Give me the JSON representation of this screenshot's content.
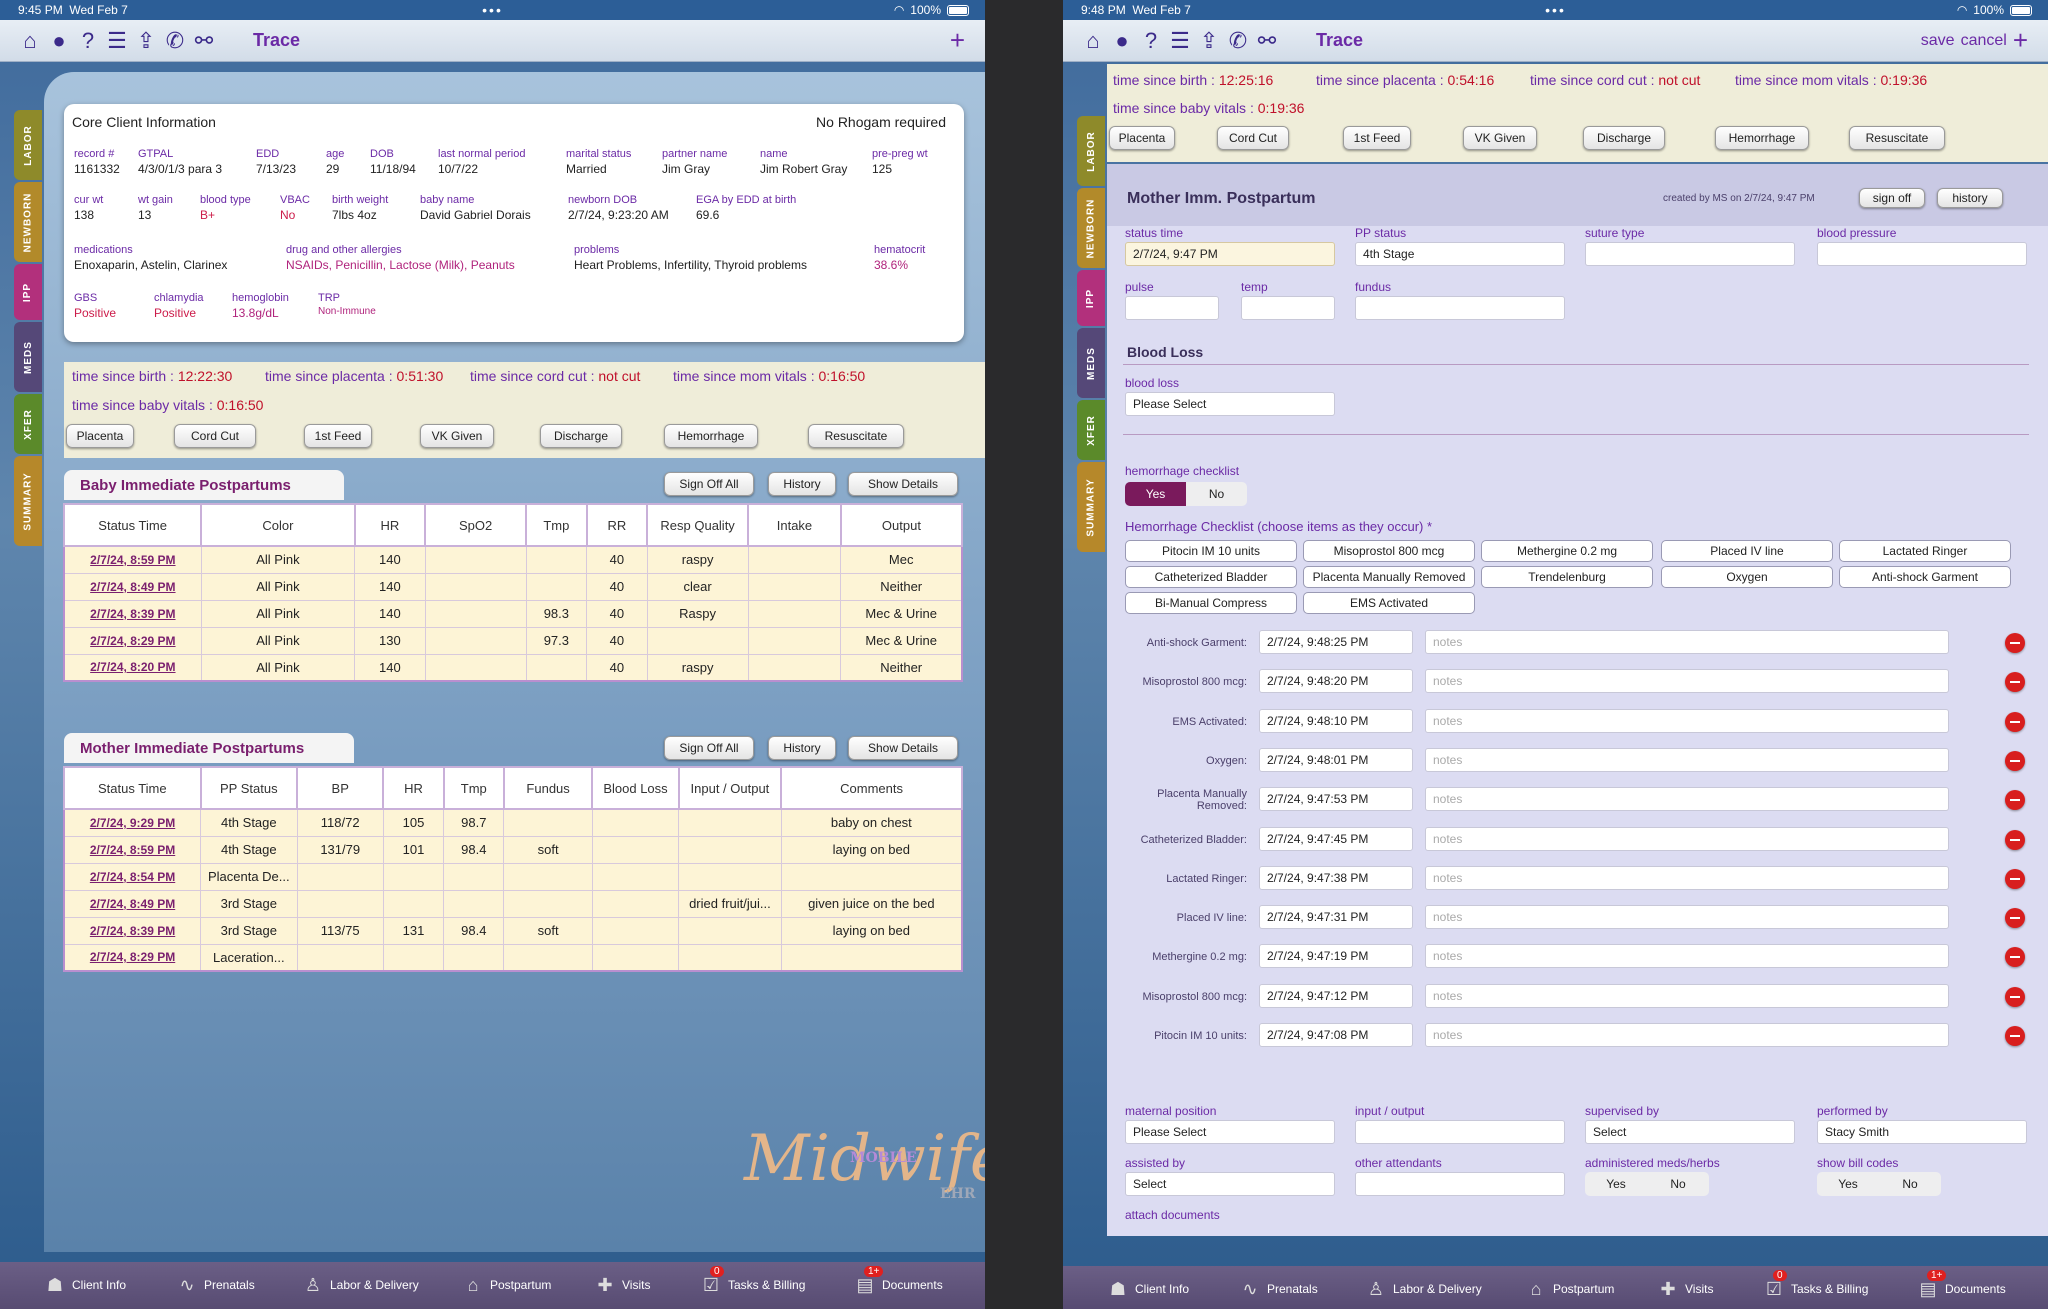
{
  "left": {
    "status": {
      "time": "9:45 PM",
      "date": "Wed Feb 7",
      "battery": "100%"
    },
    "toolbar": {
      "title": "Trace"
    },
    "sidetabs": [
      "LABOR",
      "NEWBORN",
      "IPP",
      "MEDS",
      "XFER",
      "SUMMARY"
    ],
    "core": {
      "title": "Core Client Information",
      "note": "No Rhogam required",
      "rows": [
        [
          {
            "l": "record #",
            "v": "1161332"
          },
          {
            "l": "GTPAL",
            "v": "4/3/0/1/3 para 3"
          },
          {
            "l": "EDD",
            "v": "7/13/23"
          },
          {
            "l": "age",
            "v": "29"
          },
          {
            "l": "DOB",
            "v": "11/18/94"
          },
          {
            "l": "last normal period",
            "v": "10/7/22"
          },
          {
            "l": "marital status",
            "v": "Married"
          },
          {
            "l": "partner name",
            "v": "Jim Gray"
          },
          {
            "l": "name",
            "v": "Jim Robert Gray"
          },
          {
            "l": "pre-preg wt",
            "v": "125"
          }
        ],
        [
          {
            "l": "cur wt",
            "v": "138"
          },
          {
            "l": "wt gain",
            "v": "13"
          },
          {
            "l": "blood type",
            "v": "B+"
          },
          {
            "l": "VBAC",
            "v": "No"
          },
          {
            "l": "birth weight",
            "v": "7lbs 4oz"
          },
          {
            "l": "baby name",
            "v": "David Gabriel Dorais"
          },
          {
            "l": "newborn DOB",
            "v": "2/7/24, 9:23:20 AM"
          },
          {
            "l": "EGA by EDD at birth",
            "v": "69.6"
          }
        ],
        [
          {
            "l": "medications",
            "v": "Enoxaparin, Astelin, Clarinex"
          },
          {
            "l": "drug and other allergies",
            "v": "NSAIDs, Penicillin, Lactose (Milk), Peanuts"
          },
          {
            "l": "problems",
            "v": "Heart Problems, Infertility, Thyroid problems"
          },
          {
            "l": "hematocrit",
            "v": "38.6%"
          }
        ],
        [
          {
            "l": "GBS",
            "v": "Positive"
          },
          {
            "l": "chlamydia",
            "v": "Positive"
          },
          {
            "l": "hemoglobin",
            "v": "13.8g/dL"
          },
          {
            "l": "TRP",
            "v": "Non-Immune"
          }
        ]
      ]
    },
    "timers": [
      {
        "l": "time since birth :",
        "v": "12:22:30"
      },
      {
        "l": "time since placenta :",
        "v": "0:51:30"
      },
      {
        "l": "time since cord cut :",
        "v": "not cut"
      },
      {
        "l": "time since mom vitals :",
        "v": "0:16:50"
      },
      {
        "l": "time since baby vitals :",
        "v": "0:16:50"
      }
    ],
    "actions": [
      "Placenta",
      "Cord Cut",
      "1st Feed",
      "VK Given",
      "Discharge",
      "Hemorrhage",
      "Resuscitate"
    ],
    "baby": {
      "title": "Baby Immediate Postpartums",
      "buttons": [
        "Sign Off All",
        "History",
        "Show Details"
      ],
      "headers": [
        "Status Time",
        "Color",
        "HR",
        "SpO2",
        "Tmp",
        "RR",
        "Resp Quality",
        "Intake",
        "Output"
      ],
      "rows": [
        [
          "2/7/24, 8:59 PM",
          "All Pink",
          "140",
          "",
          "",
          "40",
          "raspy",
          "",
          "Mec"
        ],
        [
          "2/7/24, 8:49 PM",
          "All Pink",
          "140",
          "",
          "",
          "40",
          "clear",
          "",
          "Neither"
        ],
        [
          "2/7/24, 8:39 PM",
          "All Pink",
          "140",
          "",
          "98.3",
          "40",
          "Raspy",
          "",
          "Mec & Urine"
        ],
        [
          "2/7/24, 8:29 PM",
          "All Pink",
          "130",
          "",
          "97.3",
          "40",
          "",
          "",
          "Mec & Urine"
        ],
        [
          "2/7/24, 8:20 PM",
          "All Pink",
          "140",
          "",
          "",
          "40",
          "raspy",
          "",
          "Neither"
        ]
      ]
    },
    "mother": {
      "title": "Mother Immediate Postpartums",
      "buttons": [
        "Sign Off All",
        "History",
        "Show Details"
      ],
      "headers": [
        "Status Time",
        "PP Status",
        "BP",
        "HR",
        "Tmp",
        "Fundus",
        "Blood Loss",
        "Input / Output",
        "Comments"
      ],
      "rows": [
        [
          "2/7/24, 9:29 PM",
          "4th Stage",
          "118/72",
          "105",
          "98.7",
          "",
          "",
          "",
          "baby on chest"
        ],
        [
          "2/7/24, 8:59 PM",
          "4th Stage",
          "131/79",
          "101",
          "98.4",
          "soft",
          "",
          "",
          "laying on bed"
        ],
        [
          "2/7/24, 8:54 PM",
          "Placenta De...",
          "",
          "",
          "",
          "",
          "",
          "",
          ""
        ],
        [
          "2/7/24, 8:49 PM",
          "3rd Stage",
          "",
          "",
          "",
          "",
          "",
          "dried fruit/jui...",
          "given juice on the bed"
        ],
        [
          "2/7/24, 8:39 PM",
          "3rd Stage",
          "113/75",
          "131",
          "98.4",
          "soft",
          "",
          "",
          "laying on bed"
        ],
        [
          "2/7/24, 8:29 PM",
          "Laceration...",
          "",
          "",
          "",
          "",
          "",
          "",
          ""
        ]
      ]
    },
    "logo": {
      "text": "Midwife",
      "mobile": "MOBILE",
      "ehr": "EHR"
    }
  },
  "nav": [
    {
      "label": "Client Info",
      "icon": "person-icon"
    },
    {
      "label": "Prenatals",
      "icon": "heartbeat-icon"
    },
    {
      "label": "Labor & Delivery",
      "icon": "baby-icon"
    },
    {
      "label": "Postpartum",
      "icon": "house-icon"
    },
    {
      "label": "Visits",
      "icon": "medkit-icon"
    },
    {
      "label": "Tasks & Billing",
      "icon": "tasks-icon",
      "badge": "0"
    },
    {
      "label": "Documents",
      "icon": "documents-icon",
      "badge": "1+"
    }
  ],
  "right": {
    "status": {
      "time": "9:48 PM",
      "date": "Wed Feb 7",
      "battery": "100%"
    },
    "toolbar": {
      "title": "Trace",
      "save": "save",
      "cancel": "cancel"
    },
    "timers": [
      {
        "l": "time since birth :",
        "v": "12:25:16"
      },
      {
        "l": "time since placenta :",
        "v": "0:54:16"
      },
      {
        "l": "time since cord cut :",
        "v": "not cut"
      },
      {
        "l": "time since mom vitals :",
        "v": "0:19:36"
      },
      {
        "l": "time since baby vitals :",
        "v": "0:19:36"
      }
    ],
    "actions": [
      "Placenta",
      "Cord Cut",
      "1st Feed",
      "VK Given",
      "Discharge",
      "Hemorrhage",
      "Resuscitate"
    ],
    "form": {
      "title": "Mother Imm. Postpartum",
      "created": "created by MS on 2/7/24, 9:47 PM",
      "signoff": "sign off",
      "history": "history",
      "status_time_label": "status time",
      "status_time": "2/7/24, 9:47 PM",
      "pp_status_label": "PP status",
      "pp_status": "4th Stage",
      "suture_label": "suture type",
      "bp_label": "blood pressure",
      "pulse_label": "pulse",
      "temp_label": "temp",
      "fundus_label": "fundus",
      "blood_loss_section": "Blood Loss",
      "blood_loss_label": "blood loss",
      "blood_loss": "Please Select",
      "hc_label": "hemorrhage checklist",
      "yes": "Yes",
      "no": "No",
      "hc_title": "Hemorrhage Checklist (choose items as they occur) *",
      "checklist": [
        "Pitocin IM 10 units",
        "Misoprostol 800 mcg",
        "Methergine 0.2 mg",
        "Placed IV line",
        "Lactated Ringer",
        "Catheterized Bladder",
        "Placenta Manually Removed",
        "Trendelenburg",
        "Oxygen",
        "Anti-shock Garment",
        "Bi-Manual Compress",
        "EMS Activated"
      ],
      "notes_placeholder": "notes",
      "log": [
        {
          "l": "Anti-shock Garment:",
          "t": "2/7/24, 9:48:25 PM"
        },
        {
          "l": "Misoprostol 800 mcg:",
          "t": "2/7/24, 9:48:20 PM"
        },
        {
          "l": "EMS Activated:",
          "t": "2/7/24, 9:48:10 PM"
        },
        {
          "l": "Oxygen:",
          "t": "2/7/24, 9:48:01 PM"
        },
        {
          "l": "Placenta Manually Removed:",
          "t": "2/7/24, 9:47:53 PM"
        },
        {
          "l": "Catheterized Bladder:",
          "t": "2/7/24, 9:47:45 PM"
        },
        {
          "l": "Lactated Ringer:",
          "t": "2/7/24, 9:47:38 PM"
        },
        {
          "l": "Placed IV line:",
          "t": "2/7/24, 9:47:31 PM"
        },
        {
          "l": "Methergine 0.2 mg:",
          "t": "2/7/24, 9:47:19 PM"
        },
        {
          "l": "Misoprostol 800 mcg:",
          "t": "2/7/24, 9:47:12 PM"
        },
        {
          "l": "Pitocin IM 10 units:",
          "t": "2/7/24, 9:47:08 PM"
        }
      ],
      "maternal_position_label": "maternal position",
      "maternal_position": "Please Select",
      "io_label": "input / output",
      "supervised_label": "supervised by",
      "supervised": "Select",
      "performed_label": "performed by",
      "performed": "Stacy Smith",
      "assisted_label": "assisted by",
      "assisted": "Select",
      "other_label": "other attendants",
      "meds_label": "administered meds/herbs",
      "bill_label": "show bill codes",
      "attach_label": "attach documents"
    }
  },
  "colors": {
    "accent": "#6b2aa6",
    "red": "#cc1c4a",
    "cream": "#fdf4d6"
  }
}
